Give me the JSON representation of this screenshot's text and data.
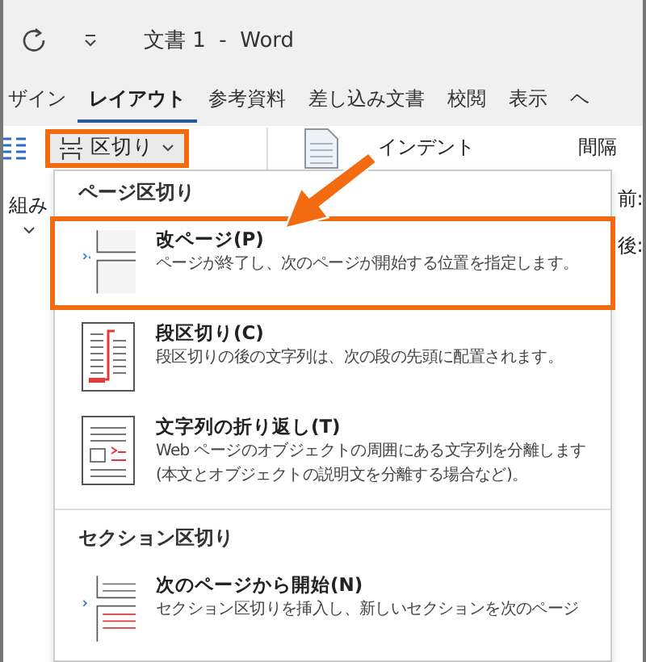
{
  "window": {
    "title": "文書 1  -  Word"
  },
  "tabs": [
    {
      "label": "ザイン",
      "selected": false
    },
    {
      "label": "レイアウト",
      "selected": true
    },
    {
      "label": "参考資料",
      "selected": false
    },
    {
      "label": "差し込み文書",
      "selected": false
    },
    {
      "label": "校閲",
      "selected": false
    },
    {
      "label": "表示",
      "selected": false
    },
    {
      "label": "ヘ",
      "selected": false
    }
  ],
  "ribbon": {
    "breaks_button": {
      "label": "区切り",
      "highlighted": true
    },
    "indent_label": "インデント",
    "spacing_label": "間隔",
    "left_label": "組み",
    "right_labels": [
      "前:",
      "後:"
    ]
  },
  "menu": {
    "sections": [
      {
        "header": "ページ区切り",
        "items": [
          {
            "kind": "page",
            "title": "改ページ(P)",
            "description": "ページが終了し、次のページが開始する位置を指定します。",
            "highlighted": true
          },
          {
            "kind": "column",
            "title": "段区切り(C)",
            "description": "段区切りの後の文字列は、次の段の先頭に配置されます。",
            "highlighted": false
          },
          {
            "kind": "wrap",
            "title": "文字列の折り返し(T)",
            "description": "Web ページのオブジェクトの周囲にある文字列を分離します (本文とオブジェクトの説明文を分離する場合など)。",
            "highlighted": false
          }
        ]
      },
      {
        "header": "セクション区切り",
        "items": [
          {
            "kind": "nextpage",
            "title": "次のページから開始(N)",
            "description": "セクション区切りを挿入し、新しいセクションを次のページ",
            "highlighted": false
          }
        ]
      }
    ]
  }
}
